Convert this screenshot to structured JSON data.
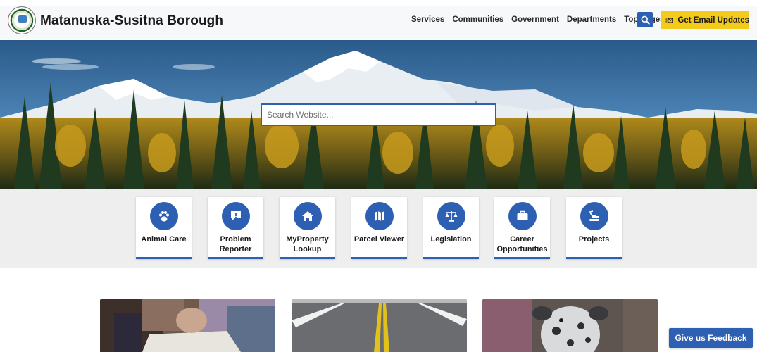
{
  "header": {
    "site_title": "Matanuska-Susitna Borough",
    "logo_icon": "borough-seal-logo",
    "nav": [
      "Services",
      "Communities",
      "Government",
      "Departments",
      "Top Pages"
    ],
    "search_icon": "search-icon",
    "email_button_label": "Get Email Updates",
    "email_icon": "envelope-list-icon",
    "accent_color": "#2d5fb3",
    "email_button_color": "#f5cb1b"
  },
  "hero": {
    "search_placeholder": "Search Website..."
  },
  "quick_links": [
    {
      "label": "Animal Care",
      "icon": "paw-icon"
    },
    {
      "label": "Problem Reporter",
      "icon": "alert-speech-bubble-icon"
    },
    {
      "label": "MyProperty Lookup",
      "icon": "home-icon"
    },
    {
      "label": "Parcel Viewer",
      "icon": "map-icon"
    },
    {
      "label": "Legislation",
      "icon": "balance-scale-icon"
    },
    {
      "label": "Career Opportunities",
      "icon": "briefcase-icon"
    },
    {
      "label": "Projects",
      "icon": "excavator-icon"
    }
  ],
  "features": [
    {
      "image": "people-signing-documents-photo"
    },
    {
      "image": "highway-road-photo"
    },
    {
      "image": "spotted-dog-photo"
    }
  ],
  "feedback_label": "Give us Feedback"
}
